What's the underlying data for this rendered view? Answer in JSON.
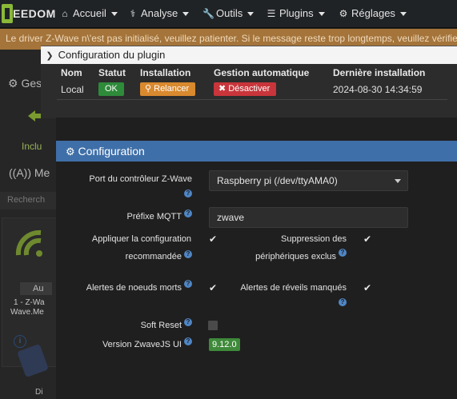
{
  "navbar": {
    "logo_text": "EEDOM",
    "items": [
      {
        "label": "Accueil",
        "icon": "home-icon"
      },
      {
        "label": "Analyse",
        "icon": "stethoscope-icon"
      },
      {
        "label": "Outils",
        "icon": "wrench-icon"
      },
      {
        "label": "Plugins",
        "icon": "list-icon"
      },
      {
        "label": "Réglages",
        "icon": "gear-icon"
      }
    ]
  },
  "alert": {
    "text": "Le driver Z-Wave n\\'est pas initialisé, veuillez patienter. Si le message reste trop longtemps, veuillez vérifier la co"
  },
  "background": {
    "gest_label": "Ges",
    "inclu_label": "Inclu",
    "me_label": "Me",
    "search_placeholder": "Recherch",
    "device_state": "Au",
    "device_name_1": "1 - Z-Wa",
    "device_name_2": "Wave.Me",
    "device2_label": "Di"
  },
  "plugin_panel": {
    "title": "Configuration du plugin",
    "headers": {
      "nom": "Nom",
      "statut": "Statut",
      "installation": "Installation",
      "gestion": "Gestion automatique",
      "derniere": "Dernière installation"
    },
    "row": {
      "nom": "Local",
      "statut": "OK",
      "installation": "Relancer",
      "gestion": "Désactiver",
      "derniere": "2024-08-30 14:34:59"
    }
  },
  "config": {
    "title": "Configuration",
    "port_label": "Port du contrôleur Z-Wave",
    "port_value": "Raspberry pi (/dev/ttyAMA0)",
    "mqtt_label": "Préfixe MQTT",
    "mqtt_value": "zwave",
    "apply_label_1": "Appliquer la configuration",
    "apply_label_2": "recommandée",
    "suppr_label_1": "Suppression des",
    "suppr_label_2": "périphériques exclus",
    "dead_label": "Alertes de noeuds morts",
    "wake_label_1": "Alertes de réveils manqués",
    "soft_reset_label": "Soft Reset",
    "version_label": "Version ZwaveJS UI",
    "version_value": "9.12.0"
  },
  "colors": {
    "ok_green": "#2e8b3a",
    "relancer_orange": "#d9892e",
    "desactiver_red": "#c8353a",
    "header_blue": "#3f6fa8",
    "alert_bg": "#a4743a"
  }
}
